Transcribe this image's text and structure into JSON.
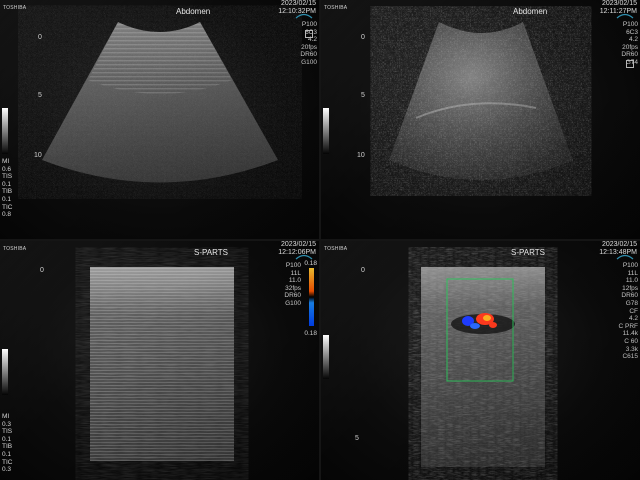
{
  "panels": [
    {
      "brand": "TOSHIBA",
      "mode": "Abdomen",
      "date": "2023/02/15",
      "time": "12:10:32PM",
      "params": [
        "P100",
        "6C3",
        "4.2",
        "20fps",
        "DR60",
        "G100"
      ],
      "left_params": [
        "MI",
        "0.6",
        "TIS",
        "0.1",
        "TIB",
        "0.1",
        "TIC",
        "0.8"
      ],
      "depth_marks": [
        "0",
        "5",
        "10"
      ]
    },
    {
      "brand": "TOSHIBA",
      "mode": "Abdomen",
      "date": "2023/02/15",
      "time": "12:11:27PM",
      "params": [
        "P100",
        "6C3",
        "4.2",
        "20fps",
        "DR60",
        "G74"
      ],
      "left_params": [],
      "depth_marks": [
        "0",
        "5",
        "10"
      ]
    },
    {
      "brand": "TOSHIBA",
      "mode": "S-PARTS",
      "date": "2023/02/15",
      "time": "12:12:06PM",
      "params": [
        "P100",
        "11L",
        "11.0",
        "32fps",
        "DR60",
        "G100"
      ],
      "scale_top": "0.18",
      "scale_bottom": "0.18",
      "left_params": [
        "MI",
        "0.3",
        "TIS",
        "0.1",
        "TIB",
        "0.1",
        "TIC",
        "0.3"
      ],
      "depth_marks": [
        "0"
      ]
    },
    {
      "brand": "TOSHIBA",
      "mode": "S-PARTS",
      "date": "2023/02/15",
      "time": "12:13:48PM",
      "params": [
        "P100",
        "11L",
        "11.0",
        "12fps",
        "DR60",
        "G78",
        "CF",
        "4.2",
        "C PRF",
        "11.4k",
        "C 60",
        "3.3k",
        "C615"
      ],
      "left_params": [],
      "depth_marks": [
        "0",
        "5"
      ]
    }
  ],
  "colors": {
    "text": "#e8e8e8",
    "doppler_red": "#ff3a1e",
    "doppler_blue": "#1e3cff",
    "roi_box": "#2dbf5a",
    "colorbar_top": "#ff6a00",
    "colorbar_bottom": "#1a6bff"
  }
}
